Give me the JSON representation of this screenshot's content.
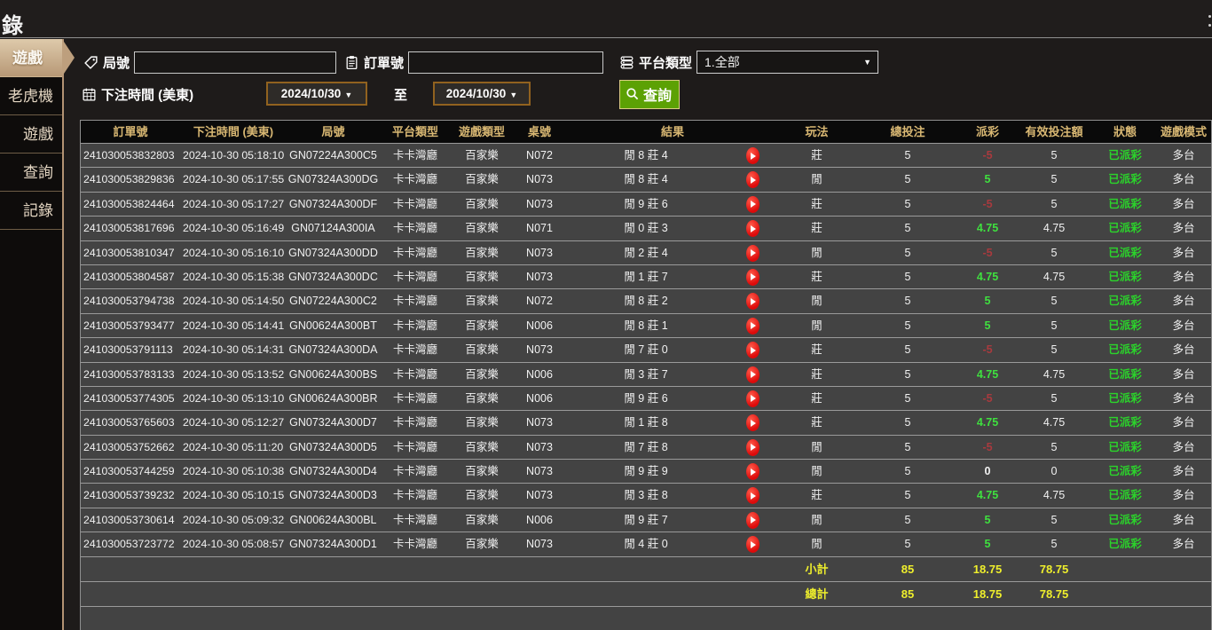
{
  "window": {
    "title_fragment": "錄"
  },
  "sidebar": {
    "items": [
      {
        "label": "遊戲",
        "active": true
      },
      {
        "label": "老虎機",
        "active": false
      },
      {
        "label": "遊戲",
        "active": false
      },
      {
        "label": "查詢",
        "active": false
      },
      {
        "label": "記錄",
        "active": false
      }
    ]
  },
  "filters": {
    "round_label": "局號",
    "round_value": "",
    "order_label": "訂單號",
    "order_value": "",
    "platform_label": "平台類型",
    "platform_value": "1.全部",
    "time_label": "下注時間 (美東)",
    "date_from": "2024/10/30",
    "to_label": "至",
    "date_to": "2024/10/30",
    "search_label": "查詢",
    "caret": "▼"
  },
  "table": {
    "headers": [
      "訂單號",
      "下注時間 (美東)",
      "局號",
      "平台類型",
      "遊戲類型",
      "桌號",
      "結果",
      "玩法",
      "總投注",
      "派彩",
      "有效投注額",
      "狀態",
      "遊戲模式"
    ],
    "rows": [
      {
        "order": "241030053832803",
        "time": "2024-10-30 05:18:10",
        "round": "GN07224A300C5",
        "platform": "卡卡灣廳",
        "game": "百家樂",
        "table": "N072",
        "result": "閒 8 莊 4",
        "bet_on": "莊",
        "total": "5",
        "payout": "-5",
        "valid": "5",
        "status": "已派彩",
        "mode": "多台"
      },
      {
        "order": "241030053829836",
        "time": "2024-10-30 05:17:55",
        "round": "GN07324A300DG",
        "platform": "卡卡灣廳",
        "game": "百家樂",
        "table": "N073",
        "result": "閒 8 莊 4",
        "bet_on": "閒",
        "total": "5",
        "payout": "5",
        "valid": "5",
        "status": "已派彩",
        "mode": "多台"
      },
      {
        "order": "241030053824464",
        "time": "2024-10-30 05:17:27",
        "round": "GN07324A300DF",
        "platform": "卡卡灣廳",
        "game": "百家樂",
        "table": "N073",
        "result": "閒 9 莊 6",
        "bet_on": "莊",
        "total": "5",
        "payout": "-5",
        "valid": "5",
        "status": "已派彩",
        "mode": "多台"
      },
      {
        "order": "241030053817696",
        "time": "2024-10-30 05:16:49",
        "round": "GN07124A300IA",
        "platform": "卡卡灣廳",
        "game": "百家樂",
        "table": "N071",
        "result": "閒 0 莊 3",
        "bet_on": "莊",
        "total": "5",
        "payout": "4.75",
        "valid": "4.75",
        "status": "已派彩",
        "mode": "多台"
      },
      {
        "order": "241030053810347",
        "time": "2024-10-30 05:16:10",
        "round": "GN07324A300DD",
        "platform": "卡卡灣廳",
        "game": "百家樂",
        "table": "N073",
        "result": "閒 2 莊 4",
        "bet_on": "閒",
        "total": "5",
        "payout": "-5",
        "valid": "5",
        "status": "已派彩",
        "mode": "多台"
      },
      {
        "order": "241030053804587",
        "time": "2024-10-30 05:15:38",
        "round": "GN07324A300DC",
        "platform": "卡卡灣廳",
        "game": "百家樂",
        "table": "N073",
        "result": "閒 1 莊 7",
        "bet_on": "莊",
        "total": "5",
        "payout": "4.75",
        "valid": "4.75",
        "status": "已派彩",
        "mode": "多台"
      },
      {
        "order": "241030053794738",
        "time": "2024-10-30 05:14:50",
        "round": "GN07224A300C2",
        "platform": "卡卡灣廳",
        "game": "百家樂",
        "table": "N072",
        "result": "閒 8 莊 2",
        "bet_on": "閒",
        "total": "5",
        "payout": "5",
        "valid": "5",
        "status": "已派彩",
        "mode": "多台"
      },
      {
        "order": "241030053793477",
        "time": "2024-10-30 05:14:41",
        "round": "GN00624A300BT",
        "platform": "卡卡灣廳",
        "game": "百家樂",
        "table": "N006",
        "result": "閒 8 莊 1",
        "bet_on": "閒",
        "total": "5",
        "payout": "5",
        "valid": "5",
        "status": "已派彩",
        "mode": "多台"
      },
      {
        "order": "241030053791113",
        "time": "2024-10-30 05:14:31",
        "round": "GN07324A300DA",
        "platform": "卡卡灣廳",
        "game": "百家樂",
        "table": "N073",
        "result": "閒 7 莊 0",
        "bet_on": "莊",
        "total": "5",
        "payout": "-5",
        "valid": "5",
        "status": "已派彩",
        "mode": "多台"
      },
      {
        "order": "241030053783133",
        "time": "2024-10-30 05:13:52",
        "round": "GN00624A300BS",
        "platform": "卡卡灣廳",
        "game": "百家樂",
        "table": "N006",
        "result": "閒 3 莊 7",
        "bet_on": "莊",
        "total": "5",
        "payout": "4.75",
        "valid": "4.75",
        "status": "已派彩",
        "mode": "多台"
      },
      {
        "order": "241030053774305",
        "time": "2024-10-30 05:13:10",
        "round": "GN00624A300BR",
        "platform": "卡卡灣廳",
        "game": "百家樂",
        "table": "N006",
        "result": "閒 9 莊 6",
        "bet_on": "莊",
        "total": "5",
        "payout": "-5",
        "valid": "5",
        "status": "已派彩",
        "mode": "多台"
      },
      {
        "order": "241030053765603",
        "time": "2024-10-30 05:12:27",
        "round": "GN07324A300D7",
        "platform": "卡卡灣廳",
        "game": "百家樂",
        "table": "N073",
        "result": "閒 1 莊 8",
        "bet_on": "莊",
        "total": "5",
        "payout": "4.75",
        "valid": "4.75",
        "status": "已派彩",
        "mode": "多台"
      },
      {
        "order": "241030053752662",
        "time": "2024-10-30 05:11:20",
        "round": "GN07324A300D5",
        "platform": "卡卡灣廳",
        "game": "百家樂",
        "table": "N073",
        "result": "閒 7 莊 8",
        "bet_on": "閒",
        "total": "5",
        "payout": "-5",
        "valid": "5",
        "status": "已派彩",
        "mode": "多台"
      },
      {
        "order": "241030053744259",
        "time": "2024-10-30 05:10:38",
        "round": "GN07324A300D4",
        "platform": "卡卡灣廳",
        "game": "百家樂",
        "table": "N073",
        "result": "閒 9 莊 9",
        "bet_on": "閒",
        "total": "5",
        "payout": "0",
        "valid": "0",
        "status": "已派彩",
        "mode": "多台"
      },
      {
        "order": "241030053739232",
        "time": "2024-10-30 05:10:15",
        "round": "GN07324A300D3",
        "platform": "卡卡灣廳",
        "game": "百家樂",
        "table": "N073",
        "result": "閒 3 莊 8",
        "bet_on": "莊",
        "total": "5",
        "payout": "4.75",
        "valid": "4.75",
        "status": "已派彩",
        "mode": "多台"
      },
      {
        "order": "241030053730614",
        "time": "2024-10-30 05:09:32",
        "round": "GN00624A300BL",
        "platform": "卡卡灣廳",
        "game": "百家樂",
        "table": "N006",
        "result": "閒 9 莊 7",
        "bet_on": "閒",
        "total": "5",
        "payout": "5",
        "valid": "5",
        "status": "已派彩",
        "mode": "多台"
      },
      {
        "order": "241030053723772",
        "time": "2024-10-30 05:08:57",
        "round": "GN07324A300D1",
        "platform": "卡卡灣廳",
        "game": "百家樂",
        "table": "N073",
        "result": "閒 4 莊 0",
        "bet_on": "閒",
        "total": "5",
        "payout": "5",
        "valid": "5",
        "status": "已派彩",
        "mode": "多台"
      }
    ],
    "subtotal": {
      "label": "小計",
      "total": "85",
      "payout": "18.75",
      "valid": "78.75"
    },
    "grand_total": {
      "label": "總計",
      "total": "85",
      "payout": "18.75",
      "valid": "78.75"
    }
  },
  "colors": {
    "accent_gold": "#d9b873",
    "sidebar_active": "#c9aa84",
    "positive": "#3fe03f",
    "negative": "#a83a3e",
    "status_paid": "#2bd32b",
    "summary_yellow": "#efef2c",
    "search_button": "#5ca104",
    "date_border": "#91621f"
  }
}
